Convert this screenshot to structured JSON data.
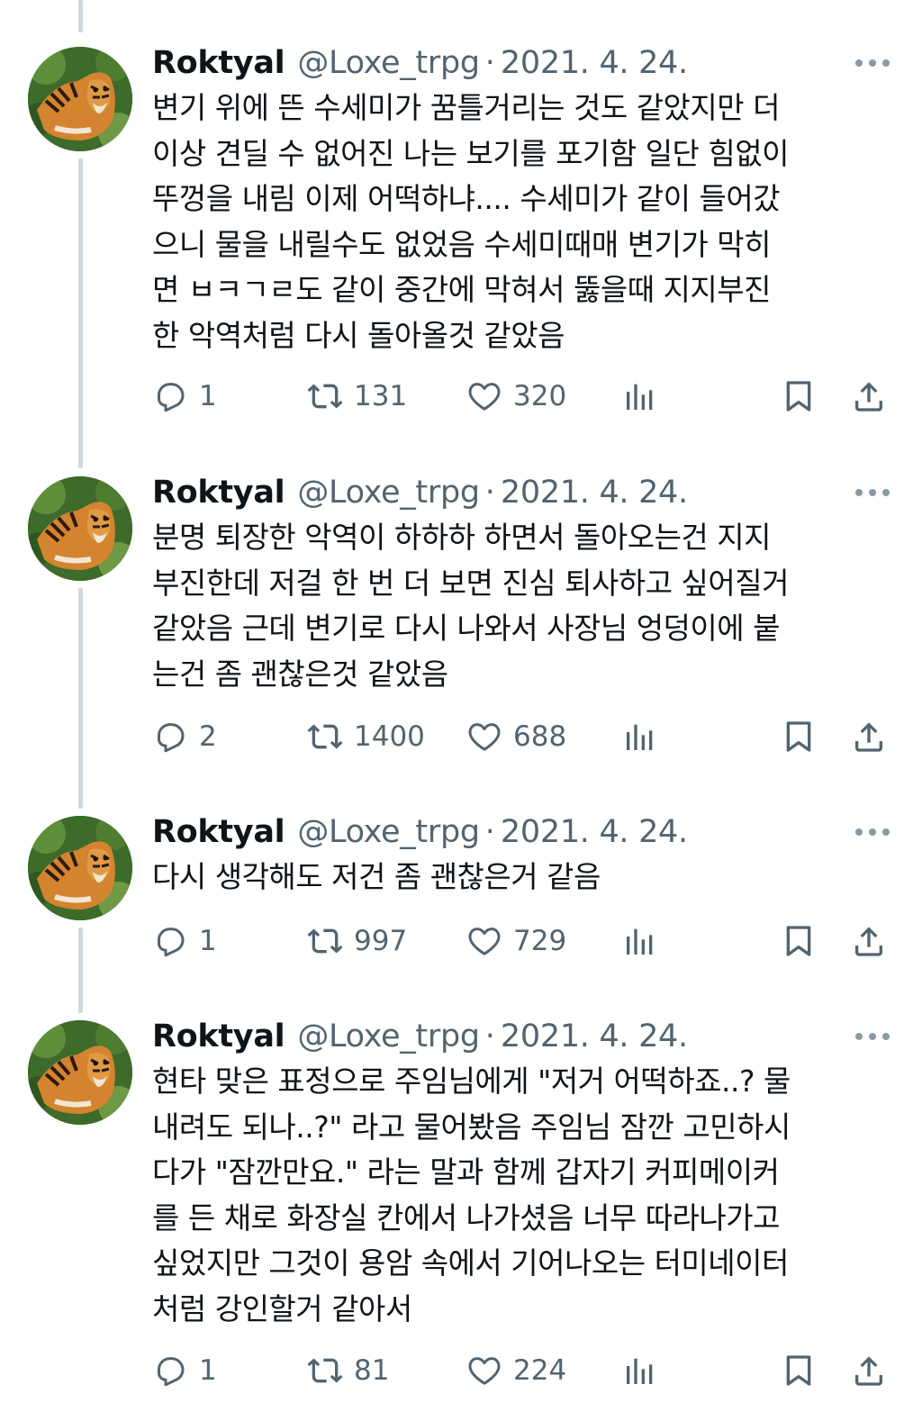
{
  "tweets": [
    {
      "name": "Roktyal",
      "handle": "@Loxe_trpg",
      "separator": "·",
      "date": "2021. 4. 24.",
      "text": "변기 위에 뜬 수세미가 꿈틀거리는 것도 같았지만 더\n이상 견딜 수 없어진 나는 보기를 포기함 일단 힘없이\n뚜껑을 내림 이제 어떡하냐.... 수세미가 같이 들어갔\n으니 물을 내릴수도 없었음 수세미때매 변기가 막히\n면 ㅂㅋㄱㄹ도 같이 중간에 막혀서 뚫을때 지지부진\n한 악역처럼 다시 돌아올것 같았음",
      "replies": "1",
      "retweets": "131",
      "likes": "320"
    },
    {
      "name": "Roktyal",
      "handle": "@Loxe_trpg",
      "separator": "·",
      "date": "2021. 4. 24.",
      "text": "분명 퇴장한 악역이 하하하 하면서 돌아오는건 지지\n부진한데 저걸 한 번 더 보면 진심 퇴사하고 싶어질거\n같았음 근데 변기로 다시 나와서 사장님 엉덩이에 붙\n는건 좀 괜찮은것 같았음",
      "replies": "2",
      "retweets": "1400",
      "likes": "688"
    },
    {
      "name": "Roktyal",
      "handle": "@Loxe_trpg",
      "separator": "·",
      "date": "2021. 4. 24.",
      "text": "다시 생각해도 저건 좀 괜찮은거 같음",
      "replies": "1",
      "retweets": "997",
      "likes": "729"
    },
    {
      "name": "Roktyal",
      "handle": "@Loxe_trpg",
      "separator": "·",
      "date": "2021. 4. 24.",
      "text": "현타 맞은 표정으로 주임님에게 \"저거 어떡하죠..? 물\n내려도 되나..?\" 라고 물어봤음 주임님 잠깐 고민하시\n다가 \"잠깐만요.\" 라는 말과 함께 갑자기 커피메이커\n를 든 채로 화장실 칸에서 나가셨음 너무 따라나가고\n싶었지만 그것이 용암 속에서 기어나오는 터미네이터\n처럼 강인할거 같아서",
      "replies": "1",
      "retweets": "81",
      "likes": "224"
    }
  ],
  "icons": {
    "more": "more-horizontal-icon",
    "reply": "reply-icon",
    "retweet": "retweet-icon",
    "like": "heart-icon",
    "views": "views-chart-icon",
    "bookmark": "bookmark-icon",
    "share": "share-icon"
  },
  "colors": {
    "text_primary": "#0f1419",
    "text_secondary": "#536471",
    "thread_line": "#cfd9de",
    "background": "#ffffff"
  }
}
